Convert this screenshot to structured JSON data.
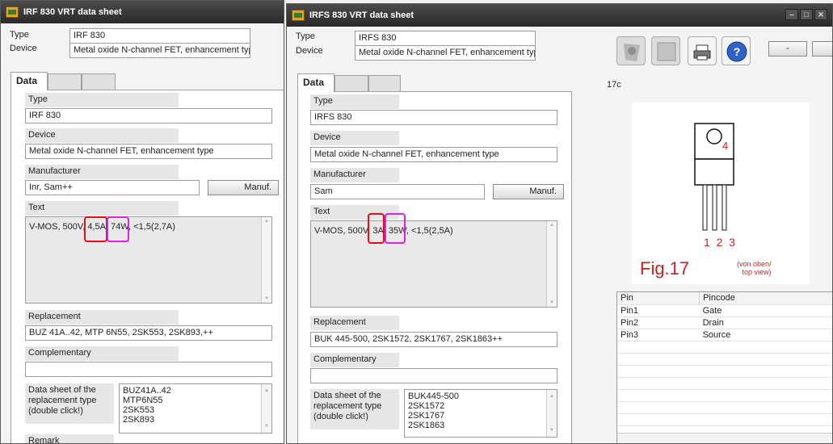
{
  "win1": {
    "title": "IRF 830 VRT data sheet",
    "type_label": "Type",
    "type_value": "IRF 830",
    "device_label": "Device",
    "device_value": "Metal oxide N-channel FET, enhancement typ",
    "tab_data": "Data",
    "data": {
      "type_label": "Type",
      "type_value": "IRF 830",
      "device_label": "Device",
      "device_value": "Metal oxide N-channel FET, enhancement type",
      "manufacturer_label": "Manufacturer",
      "manufacturer_value": "Inr, Sam++",
      "manuf_button": "Manuf.",
      "text_label": "Text",
      "text_value": "V-MOS, 500V, 4,5A, 74W, <1,5(2,7A)",
      "replacement_label": "Replacement",
      "replacement_value": "BUZ 41A..42, MTP 6N55, 2SK553, 2SK893,++",
      "complementary_label": "Complementary",
      "complementary_value": "",
      "datasheet_label": "Data sheet of the replacement type (double click!)",
      "datasheet_items": [
        "BUZ41A..42",
        "MTP6N55",
        "2SK553",
        "2SK893"
      ],
      "remark_label": "Remark"
    }
  },
  "win2": {
    "title": "IRFS 830 VRT data sheet",
    "type_label": "Type",
    "type_value": "IRFS 830",
    "device_label": "Device",
    "device_value": "Metal oxide N-channel FET, enhancement typ",
    "tab_data": "Data",
    "data": {
      "type_label": "Type",
      "type_value": "IRFS 830",
      "device_label": "Device",
      "device_value": "Metal oxide N-channel FET, enhancement type",
      "manufacturer_label": "Manufacturer",
      "manufacturer_value": "Sam",
      "manuf_button": "Manuf.",
      "text_label": "Text",
      "text_value": "V-MOS, 500V, 3A, 35W, <1,5(2,5A)",
      "replacement_label": "Replacement",
      "replacement_value": "BUK 445-500, 2SK1572, 2SK1767, 2SK1863++",
      "complementary_label": "Complementary",
      "complementary_value": "",
      "datasheet_label": "Data sheet of the replacement type (double click!)",
      "datasheet_items": [
        "BUK445-500",
        "2SK1572",
        "2SK1767",
        "2SK1863"
      ]
    },
    "package_code": "17c",
    "figure": {
      "tab_number": "4",
      "pin_numbers": "1  2  3",
      "caption": "Fig.17",
      "view_note": "(von oben/\ntop view)"
    },
    "pin_table": {
      "headers": [
        "Pin",
        "Pincode"
      ],
      "rows": [
        [
          "Pin1",
          "Gate"
        ],
        [
          "Pin2",
          "Drain"
        ],
        [
          "Pin3",
          "Source"
        ]
      ]
    },
    "min_button": "-",
    "toolbar_icons": [
      "transistor-icon",
      "blank-icon",
      "print-icon",
      "help-icon"
    ]
  },
  "colors": {
    "highlight_current": "#e01010",
    "highlight_power": "#e020e0",
    "figure_red": "#cc1f1f"
  }
}
